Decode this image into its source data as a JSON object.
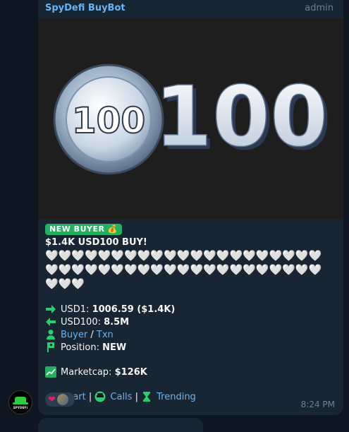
{
  "message": {
    "sender": "SpyDefi BuyBot",
    "role": "admin",
    "avatar_label": "SPYDEFI",
    "image_text": [
      "100",
      "100"
    ],
    "badge": "NEW BUYER 💰",
    "headline": "$1.4K USD100 BUY!",
    "hearts": "🤍🤍🤍🤍🤍🤍🤍🤍🤍🤍🤍🤍🤍🤍🤍🤍🤍🤍🤍🤍🤍🤍🤍🤍🤍🤍🤍🤍🤍🤍🤍🤍🤍🤍🤍🤍🤍🤍🤍🤍🤍🤍🤍🤍🤍",
    "usd1_label": "USD1:",
    "usd1_value": "1006.59 ($1.4K)",
    "usd100_label": "USD100:",
    "usd100_value": "8.5M",
    "buyer_link": "Buyer",
    "separator_slash": "/",
    "txn_link": "Txn",
    "position_label": "Position:",
    "position_value": "NEW",
    "marketcap_label": "Marketcap:",
    "marketcap_value": "$126K",
    "chart_link": "Chart",
    "calls_link": "Calls",
    "trending_link": "Trending",
    "pipe": "|",
    "time": "8:24 PM"
  },
  "colors": {
    "accent_green": "#27ae60",
    "link_blue": "#6ab3f3",
    "bubble_bg": "#182533",
    "chat_bg": "#0e1621"
  }
}
